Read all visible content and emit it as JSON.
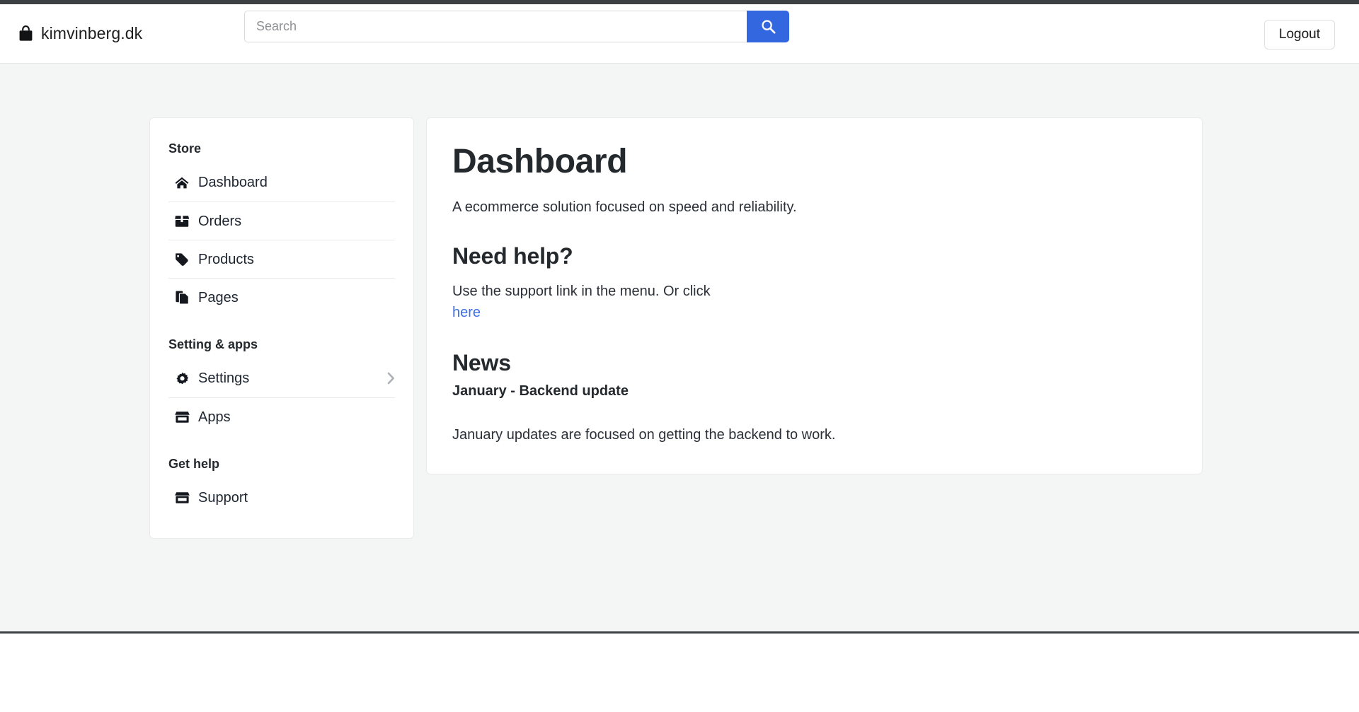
{
  "header": {
    "brand": {
      "name": "kimvinberg.dk",
      "icon": "shopping-bag-icon"
    },
    "search": {
      "placeholder": "Search",
      "value": "",
      "button_icon": "search-icon"
    },
    "logout_label": "Logout"
  },
  "sidebar": {
    "groups": [
      {
        "heading": "Store",
        "items": [
          {
            "label": "Dashboard",
            "icon": "home-icon",
            "chevron": false
          },
          {
            "label": "Orders",
            "icon": "box-icon",
            "chevron": false
          },
          {
            "label": "Products",
            "icon": "tag-icon",
            "chevron": false
          },
          {
            "label": "Pages",
            "icon": "copy-files-icon",
            "chevron": false
          }
        ]
      },
      {
        "heading": "Setting & apps",
        "items": [
          {
            "label": "Settings",
            "icon": "gear-icon",
            "chevron": true
          },
          {
            "label": "Apps",
            "icon": "store-icon",
            "chevron": false
          }
        ]
      },
      {
        "heading": "Get help",
        "items": [
          {
            "label": "Support",
            "icon": "store-icon",
            "chevron": false
          }
        ]
      }
    ]
  },
  "main": {
    "title": "Dashboard",
    "lead": "A ecommerce solution focused on speed and reliability.",
    "help": {
      "heading": "Need help?",
      "text": "Use the support link in the menu. Or click",
      "link_label": "here"
    },
    "news": {
      "heading": "News",
      "item_title": "January - Backend update",
      "item_body": "January updates are focused on getting the backend to work."
    }
  },
  "colors": {
    "accent_blue": "#3367e0",
    "link_blue": "#3d6fe6",
    "topbar_dark": "#3c4043",
    "page_bg": "#f4f5f5",
    "card_bg": "#ffffff",
    "border": "#e9eaea",
    "text": "#24292e"
  }
}
